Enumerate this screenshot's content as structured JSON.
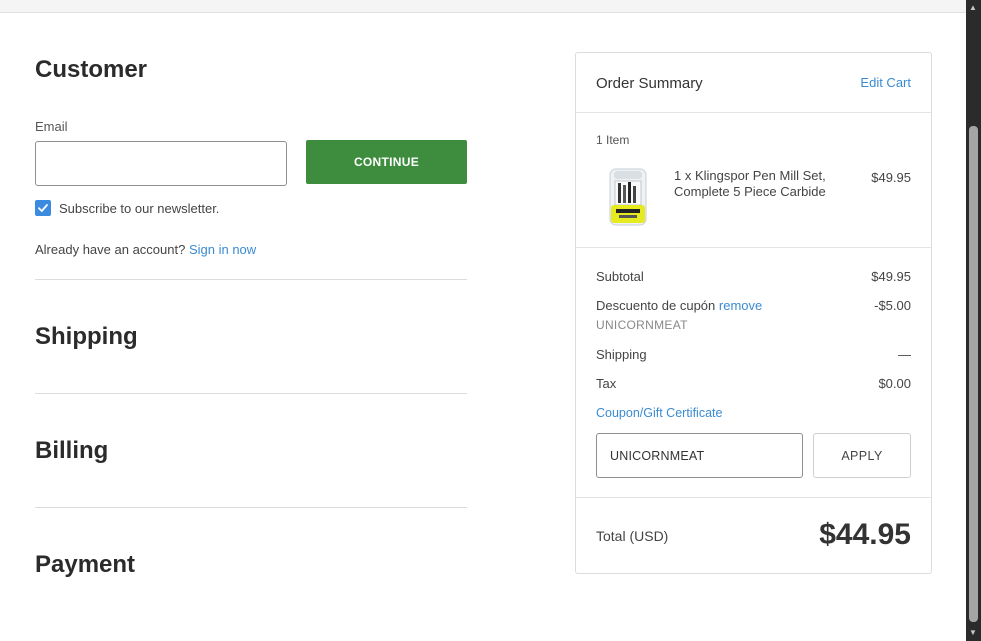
{
  "customer": {
    "title": "Customer",
    "email_label": "Email",
    "email_value": "",
    "continue_label": "CONTINUE",
    "newsletter_label": "Subscribe to our newsletter.",
    "account_prompt": "Already have an account?",
    "sign_in_label": "Sign in now"
  },
  "sections": {
    "shipping": "Shipping",
    "billing": "Billing",
    "payment": "Payment"
  },
  "summary": {
    "title": "Order Summary",
    "edit_cart": "Edit Cart",
    "items_count": "1 Item",
    "item": {
      "name": "1 x Klingspor Pen Mill Set, Complete 5 Piece Carbide",
      "price": "$49.95",
      "thumbnail_icon": "product-thumbnail"
    },
    "subtotal_label": "Subtotal",
    "subtotal_value": "$49.95",
    "discount_label": "Descuento de cupón",
    "discount_remove": "remove",
    "discount_value": "-$5.00",
    "discount_code": "UNICORNMEAT",
    "shipping_label": "Shipping",
    "shipping_value": "—",
    "tax_label": "Tax",
    "tax_value": "$0.00",
    "coupon_link": "Coupon/Gift Certificate",
    "coupon_input_value": "UNICORNMEAT",
    "apply_label": "APPLY",
    "total_label": "Total (USD)",
    "total_value": "$44.95"
  },
  "colors": {
    "accent_green": "#3e8d3e",
    "link_blue": "#3a8bd1",
    "checkbox_blue": "#3b8be0"
  }
}
